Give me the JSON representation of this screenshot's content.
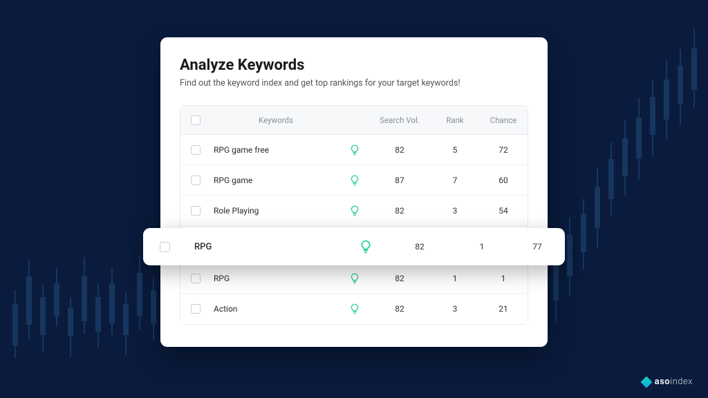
{
  "card": {
    "title": "Analyze Keywords",
    "subtitle": "Find out the keyword index and get top rankings for your target keywords!"
  },
  "table": {
    "headers": {
      "keywords": "Keywords",
      "search_vol": "Search Vol.",
      "rank": "Rank",
      "chance": "Chance"
    },
    "rows": [
      {
        "keyword": "RPG game free",
        "search_vol": "82",
        "rank": "5",
        "chance": "72"
      },
      {
        "keyword": "RPG game",
        "search_vol": "87",
        "rank": "7",
        "chance": "60"
      },
      {
        "keyword": "Role Playing",
        "search_vol": "82",
        "rank": "3",
        "chance": "54"
      },
      {
        "keyword": "RPG",
        "search_vol": "82",
        "rank": "1",
        "chance": "1"
      },
      {
        "keyword": "Action",
        "search_vol": "82",
        "rank": "3",
        "chance": "21"
      }
    ]
  },
  "highlight": {
    "keyword": "RPG",
    "search_vol": "82",
    "rank": "1",
    "chance": "77"
  },
  "brand": {
    "part1": "aso",
    "part2": "index"
  },
  "colors": {
    "bg": "#0a1b3d",
    "accent": "#14d6c2",
    "bulb": "#28d19a"
  }
}
